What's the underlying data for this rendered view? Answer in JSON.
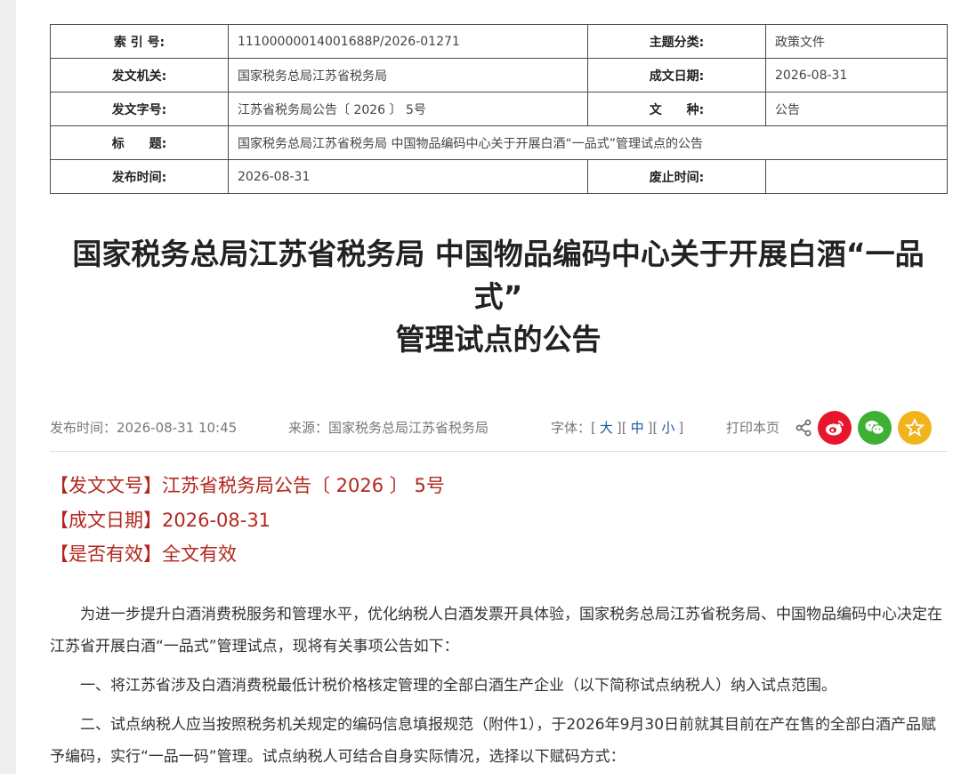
{
  "meta_table": {
    "index_no_label": "索 引 号:",
    "index_no": "11100000014001688P/2026-01271",
    "subject_label": "主题分类:",
    "subject": "政策文件",
    "issuer_label": "发文机关:",
    "issuer": "国家税务总局江苏省税务局",
    "date_label": "成文日期:",
    "date": "2026-08-31",
    "doc_no_label": "发文字号:",
    "doc_no": "江苏省税务局公告〔 2026 〕 5号",
    "type_label": "文　　种:",
    "type": "公告",
    "title_label": "标　　题:",
    "title": "国家税务总局江苏省税务局 中国物品编码中心关于开展白酒“一品式”管理试点的公告",
    "publish_label": "发布时间:",
    "publish": "2026-08-31",
    "expire_label": "废止时间:",
    "expire": ""
  },
  "article": {
    "title_line1": "国家税务总局江苏省税务局 中国物品编码中心关于开展白酒“一品",
    "title_line2": "式”",
    "title_line3": "管理试点的公告"
  },
  "infobar": {
    "publish_time": "发布时间：2026-08-31 10:45",
    "source": "来源：国家税务总局江苏省税务局",
    "font_label": "字体：",
    "font_large": "大",
    "font_medium": "中",
    "font_small": "小",
    "print": "打印本页"
  },
  "doc_info": {
    "doc_no": "【发文文号】江苏省税务局公告〔 2026 〕 5号",
    "date": "【成文日期】2026-08-31",
    "validity": "【是否有效】全文有效"
  },
  "body": {
    "p1": "为进一步提升白酒消费税服务和管理水平，优化纳税人白酒发票开具体验，国家税务总局江苏省税务局、中国物品编码中心决定在江苏省开展白酒“一品式”管理试点，现将有关事项公告如下：",
    "p2": "一、将江苏省涉及白酒消费税最低计税价格核定管理的全部白酒生产企业（以下简称试点纳税人）纳入试点范围。",
    "p3": "二、试点纳税人应当按照税务机关规定的编码信息填报规范（附件1），于2026年9月30日前就其目前在产在售的全部白酒产品赋予编码，实行“一品一码”管理。试点纳税人可结合自身实际情况，选择以下赋码方式："
  },
  "colors": {
    "accent_red": "#b3261e",
    "link_blue": "#1a5aa6",
    "weibo": "#e6162d",
    "wechat": "#3eb135",
    "favorite": "#f2b41d"
  },
  "icons": [
    "share-icon",
    "weibo-icon",
    "wechat-icon",
    "favorite-icon"
  ]
}
